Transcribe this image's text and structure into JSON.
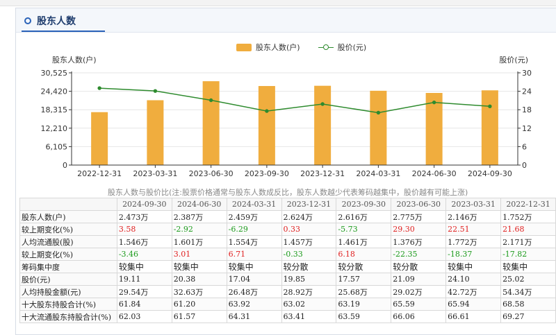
{
  "header": {
    "title": "股东人数"
  },
  "colors": {
    "bar": "#f0ad3e",
    "line": "#2e8b2e",
    "axis": "#333333",
    "positive": "#e02020",
    "negative": "#1a9a1a"
  },
  "chart_data": {
    "type": "bar",
    "categories": [
      "2022-12-31",
      "2023-03-31",
      "2023-06-30",
      "2023-09-30",
      "2023-12-31",
      "2024-03-31",
      "2024-06-30",
      "2024-09-30"
    ],
    "series": [
      {
        "name": "股东人数(户)",
        "type": "bar",
        "axis": "left",
        "values": [
          17520,
          21460,
          27750,
          26160,
          26240,
          24590,
          23870,
          24730
        ]
      },
      {
        "name": "股价(元)",
        "type": "line",
        "axis": "right",
        "values": [
          25.02,
          24.1,
          21.09,
          17.57,
          19.85,
          17.04,
          20.38,
          19.11
        ]
      }
    ],
    "ylabel": "股东人数(户)",
    "y2label": "股价(元)",
    "ylim": [
      0,
      30525
    ],
    "yticks": [
      "30,525",
      "24,420",
      "18,315",
      "12,210",
      "6,105",
      "0"
    ],
    "y2lim": [
      0,
      30
    ],
    "y2ticks": [
      "30",
      "24",
      "18",
      "12",
      "6",
      "0"
    ],
    "grid": true,
    "legend": "top-center"
  },
  "chart_note": "股东人数与股价比(注:股票价格通常与股东人数成反比，股东人数越少代表筹码越集中，股价越有可能上涨)",
  "table": {
    "headers": [
      "2024-09-30",
      "2024-06-30",
      "2024-03-31",
      "2023-12-31",
      "2023-09-30",
      "2023-06-30",
      "2023-03-31",
      "2022-12-31"
    ],
    "rows": [
      {
        "label": "股东人数(户)",
        "values": [
          "2.473万",
          "2.387万",
          "2.459万",
          "2.624万",
          "2.616万",
          "2.775万",
          "2.146万",
          "1.752万"
        ]
      },
      {
        "label": "较上期变化(%)",
        "values": [
          "3.58",
          "-2.92",
          "-6.29",
          "0.33",
          "-5.73",
          "29.30",
          "22.51",
          "21.68"
        ],
        "signed": true
      },
      {
        "label": "人均流通股(股)",
        "values": [
          "1.546万",
          "1.601万",
          "1.554万",
          "1.457万",
          "1.461万",
          "1.376万",
          "1.772万",
          "2.171万"
        ]
      },
      {
        "label": "较上期变化(%)",
        "values": [
          "-3.46",
          "3.01",
          "6.71",
          "-0.33",
          "6.18",
          "-22.35",
          "-18.37",
          "-17.82"
        ],
        "signed": true
      },
      {
        "label": "筹码集中度",
        "values": [
          "较集中",
          "较集中",
          "较集中",
          "较分散",
          "较分散",
          "较分散",
          "较集中",
          "较集中"
        ],
        "large": true
      },
      {
        "label": "股价(元)",
        "values": [
          "19.11",
          "20.38",
          "17.04",
          "19.85",
          "17.57",
          "21.09",
          "24.10",
          "25.02"
        ]
      },
      {
        "label": "人均持股金额(元)",
        "values": [
          "29.54万",
          "32.63万",
          "26.48万",
          "28.92万",
          "25.68万",
          "29.02万",
          "42.72万",
          "54.34万"
        ]
      },
      {
        "label": "十大股东持股合计(%)",
        "values": [
          "61.84",
          "61.20",
          "63.92",
          "63.02",
          "63.19",
          "65.59",
          "65.94",
          "68.58"
        ]
      },
      {
        "label": "十大流通股东持股合计(%)",
        "values": [
          "62.03",
          "61.57",
          "64.31",
          "63.41",
          "63.59",
          "66.06",
          "66.61",
          "69.27"
        ]
      }
    ]
  }
}
